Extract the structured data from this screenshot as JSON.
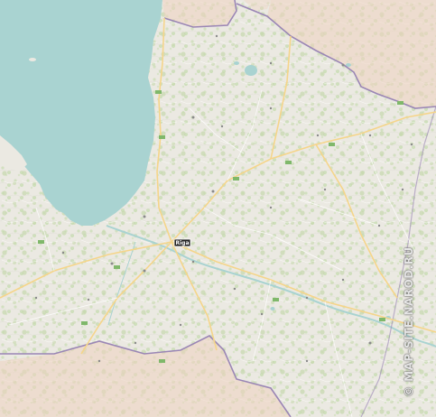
{
  "map": {
    "colors": {
      "sea": "#a9d3d1",
      "land": "#ebe9e2",
      "forest": "#c9dbb4",
      "border": "#9a86b5",
      "neighbor_tint": "#efd2c0",
      "road_major": "#f5d58a",
      "highway_badge": "#7fb86a",
      "capital_badge": "#222222"
    },
    "capital_label": "Rīga",
    "watermark": "© MAP-SITE.NAROD.RU"
  }
}
